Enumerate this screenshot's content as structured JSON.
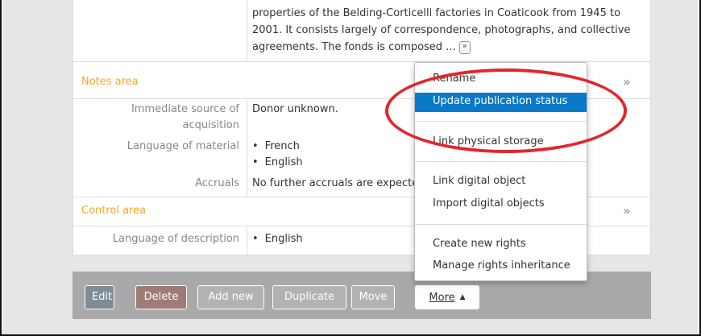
{
  "summary": {
    "lines": [
      "properties of the Belding-Corticelli factories in Coaticook from 1945 to",
      "2001. It consists largely of correspondence, photographs, and collective",
      "agreements. The fonds is composed ..."
    ],
    "expand_icon": "»"
  },
  "notes_area": {
    "title": "Notes area",
    "toggle_icon": "»",
    "immediate_source_label": "Immediate source of acquisition",
    "immediate_source_value": "Donor unknown.",
    "language_label": "Language of material",
    "languages": [
      "French",
      "English"
    ],
    "accruals_label": "Accruals",
    "accruals_value": "No further accruals are expecte"
  },
  "control_area": {
    "title": "Control area",
    "toggle_icon": "»",
    "lang_desc_label": "Language of description",
    "lang_desc_values": [
      "English"
    ]
  },
  "actions": {
    "edit": "Edit",
    "delete": "Delete",
    "add_new": "Add new",
    "duplicate": "Duplicate",
    "move": "Move",
    "more": "More",
    "more_caret": "▲"
  },
  "more_menu": {
    "items": [
      "Rename",
      "Update publication status",
      "Link physical storage",
      "Link digital object",
      "Import digital objects",
      "Create new rights",
      "Manage rights inheritance"
    ],
    "highlighted": "Update publication status"
  },
  "colors": {
    "section_title": "#f5a623",
    "menu_highlight": "#0a79c7",
    "annotation": "#e3262b"
  }
}
